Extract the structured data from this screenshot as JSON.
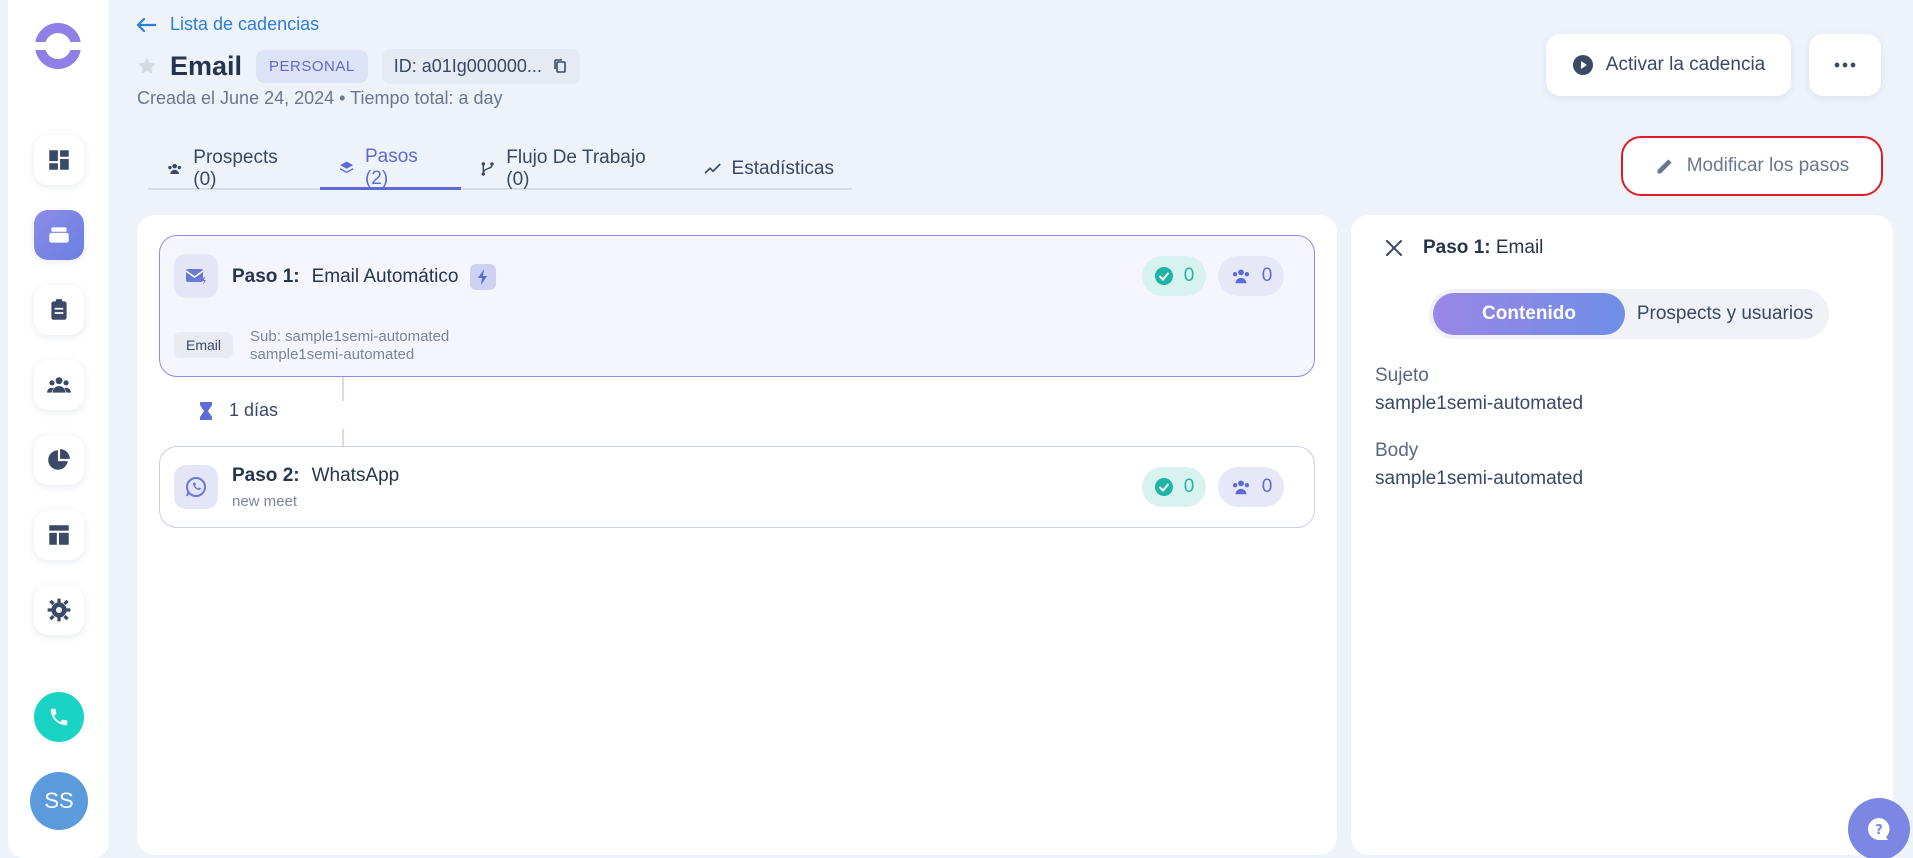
{
  "header": {
    "back_label": "Lista de cadencias",
    "title": "Email",
    "badge": "PERSONAL",
    "id_label": "ID: a01Ig000000...",
    "subtitle": "Creada el June 24, 2024 • Tiempo total: a day",
    "activate_label": "Activar la cadencia",
    "modify_label": "Modificar los pasos"
  },
  "tabs": [
    {
      "label": "Prospects (0)",
      "icon": "users-icon"
    },
    {
      "label": "Pasos (2)",
      "icon": "layers-icon"
    },
    {
      "label": "Flujo De Trabajo (0)",
      "icon": "workflow-icon"
    },
    {
      "label": "Estadísticas",
      "icon": "chart-line-icon"
    }
  ],
  "active_tab": "Pasos (2)",
  "steps": [
    {
      "prefix": "Paso 1:",
      "name": "Email Automático",
      "completed": "0",
      "people": "0",
      "tag": "Email",
      "line1": "Sub: sample1semi-automated",
      "line2": "sample1semi-automated"
    },
    {
      "prefix": "Paso 2:",
      "name": "WhatsApp",
      "completed": "0",
      "people": "0",
      "line1": "new meet"
    }
  ],
  "delay_label": "1 días",
  "side_panel": {
    "title_prefix": "Paso 1:",
    "title_name": "Email",
    "seg_active": "Contenido",
    "seg_other": "Prospects y usuarios",
    "subject_label": "Sujeto",
    "subject_value": "sample1semi-automated",
    "body_label": "Body",
    "body_value": "sample1semi-automated"
  },
  "user": {
    "initials": "SS"
  },
  "colors": {
    "accent": "#5c6bd8",
    "link": "#2b7de0",
    "highlight": "#e01b24",
    "teal": "#19d3c5"
  }
}
